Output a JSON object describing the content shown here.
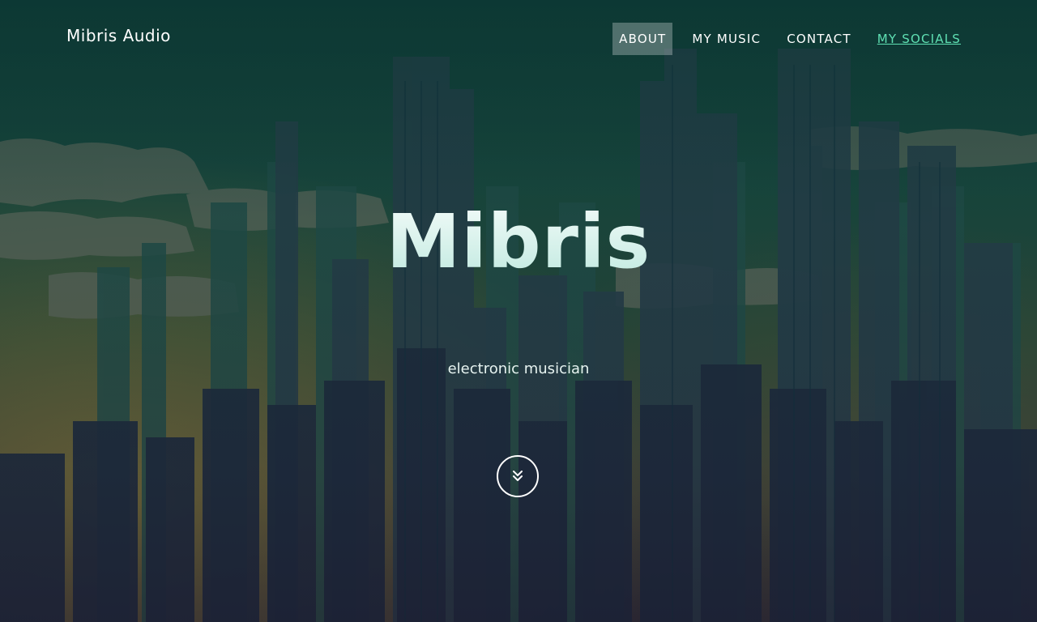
{
  "brand": {
    "name": "Mibris Audio"
  },
  "nav": {
    "items": [
      {
        "label": "ABOUT"
      },
      {
        "label": "MY MUSIC"
      },
      {
        "label": "CONTACT"
      },
      {
        "label": "MY SOCIALS"
      }
    ]
  },
  "hero": {
    "title": "Mibris",
    "subtitle": "electronic musician",
    "scroll_icon": "double-chevron-down-icon"
  },
  "colors": {
    "accent": "#5fe0b3",
    "title": "#d4f2ec",
    "background_top": "#0f3a36",
    "background_bottom": "#2f2b38"
  }
}
